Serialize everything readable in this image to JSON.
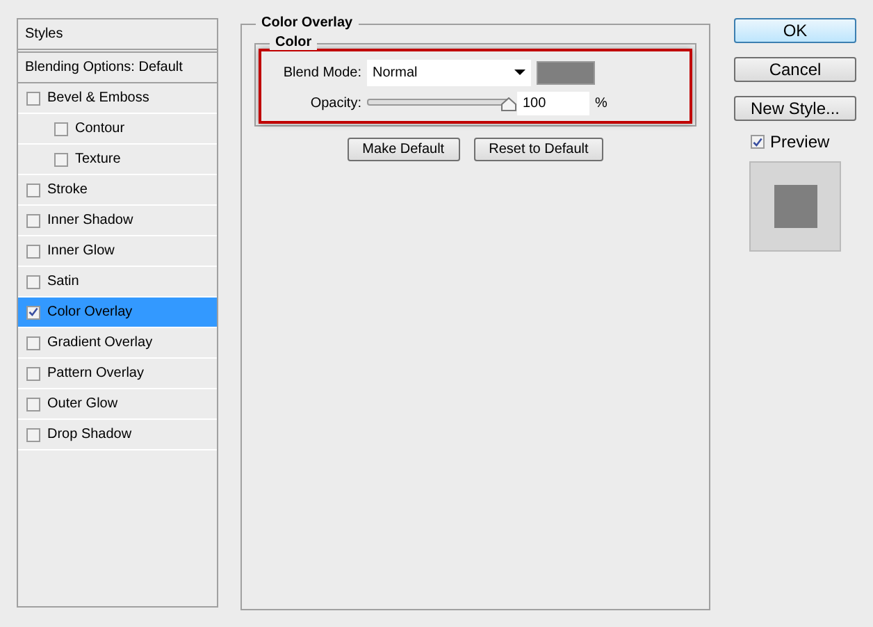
{
  "sidebar": {
    "title": "Styles",
    "blending_options": "Blending Options: Default",
    "items": [
      {
        "label": "Bevel & Emboss",
        "checked": false,
        "selected": false,
        "children": [
          {
            "label": "Contour",
            "checked": false,
            "selected": false
          },
          {
            "label": "Texture",
            "checked": false,
            "selected": false
          }
        ]
      },
      {
        "label": "Stroke",
        "checked": false,
        "selected": false
      },
      {
        "label": "Inner Shadow",
        "checked": false,
        "selected": false
      },
      {
        "label": "Inner Glow",
        "checked": false,
        "selected": false
      },
      {
        "label": "Satin",
        "checked": false,
        "selected": false
      },
      {
        "label": "Color Overlay",
        "checked": true,
        "selected": true
      },
      {
        "label": "Gradient Overlay",
        "checked": false,
        "selected": false
      },
      {
        "label": "Pattern Overlay",
        "checked": false,
        "selected": false
      },
      {
        "label": "Outer Glow",
        "checked": false,
        "selected": false
      },
      {
        "label": "Drop Shadow",
        "checked": false,
        "selected": false
      }
    ]
  },
  "panel": {
    "title": "Color Overlay",
    "group_title": "Color",
    "blend_mode": {
      "label": "Blend Mode:",
      "value": "Normal"
    },
    "color": "#7f7f7f",
    "opacity": {
      "label": "Opacity:",
      "level": 1,
      "value": "100",
      "unit": "%"
    },
    "highlighted": true,
    "buttons": [
      "Make Default",
      "Reset to Default"
    ]
  },
  "actions": [
    {
      "label": "OK",
      "default": true
    },
    {
      "label": "Cancel",
      "default": false
    },
    {
      "label": "New Style...",
      "default": false
    }
  ],
  "preview": {
    "label": "Preview",
    "checked": true
  }
}
